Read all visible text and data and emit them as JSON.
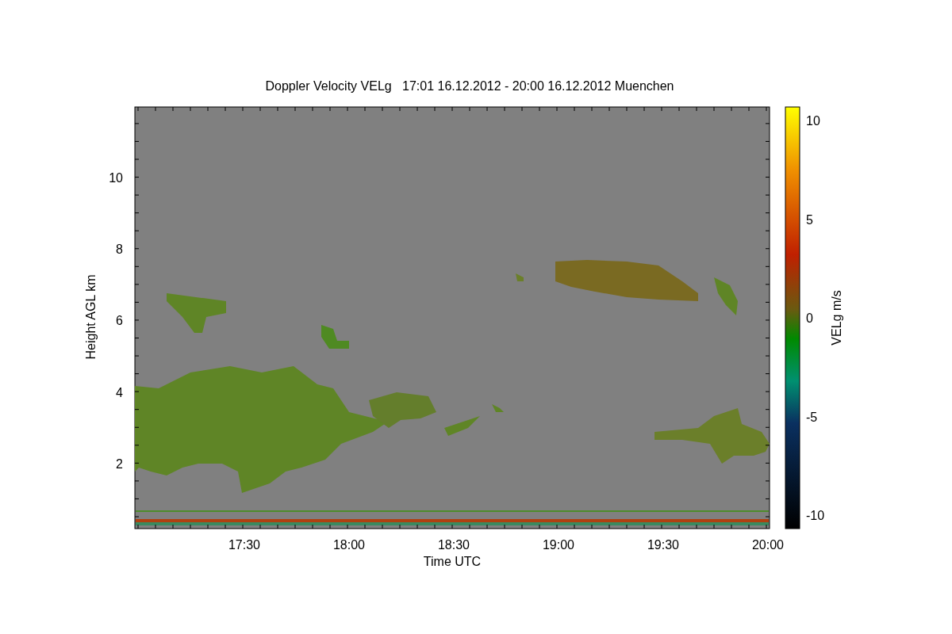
{
  "title": "Doppler Velocity VELg   17:01 16.12.2012 - 20:00 16.12.2012 Muenchen",
  "x_axis": {
    "label": "Time UTC",
    "ticks": [
      "17:30",
      "18:00",
      "18:30",
      "19:00",
      "19:30",
      "20:00"
    ]
  },
  "y_axis": {
    "label": "Height AGL km",
    "ticks": [
      "10",
      "8",
      "6",
      "4",
      "2"
    ]
  },
  "colorbar": {
    "label": "VELg m/s",
    "ticks": [
      "10",
      "5",
      "0",
      "-5",
      "-10"
    ]
  }
}
